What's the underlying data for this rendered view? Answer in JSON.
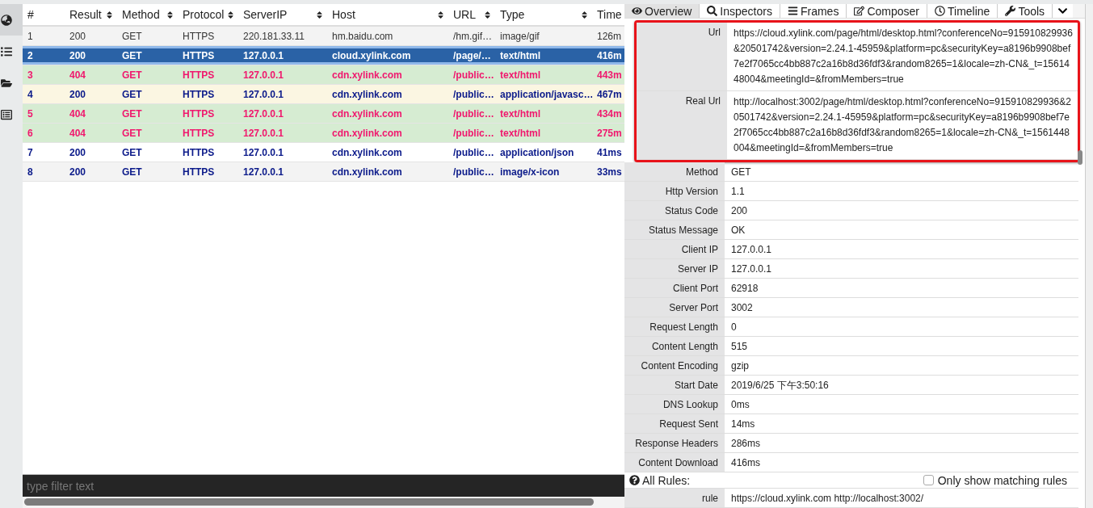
{
  "sidebar": {
    "items": [
      {
        "selected": true
      },
      {
        "selected": false
      },
      {
        "selected": false
      },
      {
        "selected": false
      }
    ]
  },
  "table": {
    "columns": [
      {
        "label": "#",
        "sortable": false
      },
      {
        "label": "Result",
        "sortable": true
      },
      {
        "label": "Method",
        "sortable": true
      },
      {
        "label": "Protocol",
        "sortable": true
      },
      {
        "label": "ServerIP",
        "sortable": true
      },
      {
        "label": "Host",
        "sortable": true
      },
      {
        "label": "URL",
        "sortable": true
      },
      {
        "label": "Type",
        "sortable": true
      },
      {
        "label": "Time"
      }
    ],
    "rows": [
      {
        "kind": "plain",
        "selected": false,
        "cells": [
          "1",
          "200",
          "GET",
          "HTTPS",
          "220.181.33.11",
          "hm.baidu.com",
          "/hm.gif…",
          "image/gif",
          "126m"
        ]
      },
      {
        "kind": "ok",
        "selected": true,
        "cells": [
          "2",
          "200",
          "GET",
          "HTTPS",
          "127.0.0.1",
          "cloud.xylink.com",
          "/page/…",
          "text/html",
          "416m"
        ]
      },
      {
        "kind": "error",
        "selected": false,
        "cells": [
          "3",
          "404",
          "GET",
          "HTTPS",
          "127.0.0.1",
          "cdn.xylink.com",
          "/public…",
          "text/html",
          "443m"
        ]
      },
      {
        "kind": "script",
        "selected": false,
        "cells": [
          "4",
          "200",
          "GET",
          "HTTPS",
          "127.0.0.1",
          "cdn.xylink.com",
          "/public…",
          "application/javasc…",
          "467m"
        ]
      },
      {
        "kind": "error",
        "selected": false,
        "cells": [
          "5",
          "404",
          "GET",
          "HTTPS",
          "127.0.0.1",
          "cdn.xylink.com",
          "/public…",
          "text/html",
          "434m"
        ]
      },
      {
        "kind": "error",
        "selected": false,
        "cells": [
          "6",
          "404",
          "GET",
          "HTTPS",
          "127.0.0.1",
          "cdn.xylink.com",
          "/public…",
          "text/html",
          "275m"
        ]
      },
      {
        "kind": "ok",
        "selected": false,
        "cells": [
          "7",
          "200",
          "GET",
          "HTTPS",
          "127.0.0.1",
          "cdn.xylink.com",
          "/public…",
          "application/json",
          "41ms"
        ]
      },
      {
        "kind": "ok",
        "selected": false,
        "cells": [
          "8",
          "200",
          "GET",
          "HTTPS",
          "127.0.0.1",
          "cdn.xylink.com",
          "/public…",
          "image/x-icon",
          "33ms"
        ]
      }
    ],
    "filter": {
      "placeholder": "type filter text"
    }
  },
  "details": {
    "tabs": [
      {
        "label": "Overview",
        "selected": true
      },
      {
        "label": "Inspectors",
        "selected": false
      },
      {
        "label": "Frames",
        "selected": false
      },
      {
        "label": "Composer",
        "selected": false
      },
      {
        "label": "Timeline",
        "selected": false
      },
      {
        "label": "Tools",
        "selected": false
      }
    ],
    "overview": [
      {
        "label": "Url",
        "value": "https://cloud.xylink.com/page/html/desktop.html?conferenceNo=915910829936&20501742&version=2.24.1-45959&platform=pc&securityKey=a8196b9908bef7e2f7065cc4bb887c2a16b8d36fdf3&random8265=1&locale=zh-CN&_t=1561448004&meetingId=&fromMembers=true",
        "highlighted": true
      },
      {
        "label": "Real Url",
        "value": "http://localhost:3002/page/html/desktop.html?conferenceNo=915910829936&20501742&version=2.24.1-45959&platform=pc&securityKey=a8196b9908bef7e2f7065cc4bb887c2a16b8d36fdf3&random8265=1&locale=zh-CN&_t=1561448004&meetingId=&fromMembers=true",
        "highlighted": true
      },
      {
        "label": "Method",
        "value": "GET",
        "highlighted": false
      },
      {
        "label": "Http Version",
        "value": "1.1",
        "highlighted": false
      },
      {
        "label": "Status Code",
        "value": "200",
        "highlighted": false
      },
      {
        "label": "Status Message",
        "value": "OK",
        "highlighted": false
      },
      {
        "label": "Client IP",
        "value": "127.0.0.1",
        "highlighted": false
      },
      {
        "label": "Server IP",
        "value": "127.0.0.1",
        "highlighted": false
      },
      {
        "label": "Client Port",
        "value": "62918",
        "highlighted": false
      },
      {
        "label": "Server Port",
        "value": "3002",
        "highlighted": false
      },
      {
        "label": "Request Length",
        "value": "0",
        "highlighted": false
      },
      {
        "label": "Content Length",
        "value": "515",
        "highlighted": false
      },
      {
        "label": "Content Encoding",
        "value": "gzip",
        "highlighted": false
      },
      {
        "label": "Start Date",
        "value": "2019/6/25 下午3:50:16",
        "highlighted": false
      },
      {
        "label": "DNS Lookup",
        "value": "0ms",
        "highlighted": false
      },
      {
        "label": "Request Sent",
        "value": "14ms",
        "highlighted": false
      },
      {
        "label": "Response Headers",
        "value": "286ms",
        "highlighted": false
      },
      {
        "label": "Content Download",
        "value": "416ms",
        "highlighted": false
      }
    ],
    "rules": {
      "title": "All Rules:",
      "only_matching": {
        "label": "Only show matching rules",
        "checked": false
      },
      "rows": [
        {
          "label": "rule",
          "value": "https://cloud.xylink.com http://localhost:3002/"
        }
      ]
    }
  }
}
